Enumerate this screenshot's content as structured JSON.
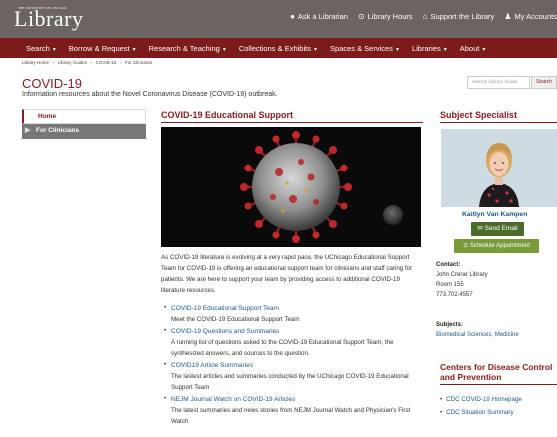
{
  "header": {
    "logo_small": "THE UNIVERSITY OF CHICAGO",
    "logo_big": "Library",
    "links": [
      {
        "icon": "chat-icon",
        "glyph": "💬",
        "label": "Ask a Librarian"
      },
      {
        "icon": "clock-icon",
        "glyph": "⊙",
        "label": "Library Hours"
      },
      {
        "icon": "bank-icon",
        "glyph": "⌂",
        "label": "Support the Library"
      },
      {
        "icon": "user-icon",
        "glyph": "♟",
        "label": "My Accounts"
      }
    ]
  },
  "nav": [
    {
      "label": "Search",
      "caret": "▾"
    },
    {
      "label": "Borrow & Request",
      "caret": "▾"
    },
    {
      "label": "Research & Teaching",
      "caret": "▾"
    },
    {
      "label": "Collections & Exhibits",
      "caret": "▾"
    },
    {
      "label": "Spaces & Services",
      "caret": "▾"
    },
    {
      "label": "Libraries",
      "caret": "▾"
    },
    {
      "label": "About",
      "caret": "▾"
    }
  ],
  "breadcrumb": [
    "Library Home",
    "Library Guides",
    "COVID-19",
    "For Clinicians"
  ],
  "page": {
    "title": "COVID-19",
    "subtitle": "Information resources about the Novel Coronavirus Disease (COVID-19) outbreak."
  },
  "search": {
    "placeholder": "Search Library Guide",
    "button": "Search"
  },
  "sidebar": {
    "items": [
      {
        "label": "Home"
      },
      {
        "label": "For Clinicians"
      }
    ]
  },
  "main": {
    "heading": "COVID-19 Educational Support",
    "paragraph": "As COVID-19 literature is evolving at a very rapid pace, the UChicago Educational Support Team for COVID-19 is offering an educational support team for clinicians and staff caring for patients. We are here to support your team by providing access to additional COVID-19 literature resources.",
    "resources": [
      {
        "link": "COVID-19 Educational Support Team",
        "desc": "Meet the COVID-19 Educational Support Team"
      },
      {
        "link": "COVID-19 Questions and Summaries",
        "desc": "A running list of questions asked to the COVID-19 Educational Support Team, the synthesized answers, and sources to the question."
      },
      {
        "link": "COVID19 Article Summaries",
        "desc": "The lastest articles and summaries conducted by the UChicago COVID-19 Educational Support Team"
      },
      {
        "link": "NEJM Journal Watch on COVID-19 Articles",
        "desc": "The latest summaries and news stories from NEJM Journal Watch and Physician's First Watch"
      }
    ]
  },
  "specialist": {
    "heading": "Subject Specialist",
    "name": "Kaitlyn Van Kampen",
    "email_button": "Send Email",
    "schedule_button": "Schedule Appointment",
    "contact_label": "Contact:",
    "contact_lines": [
      "John Crerar Library",
      "Room 155",
      "773.702.4557"
    ],
    "subjects_label": "Subjects:",
    "subjects": [
      "Biomedical Sciences",
      "Medicine"
    ]
  },
  "cdc": {
    "heading": "Centers for Disease Control and Prevention",
    "links": [
      "CDC COVID-19 Homepage",
      "CDC Situation Summary"
    ]
  },
  "colors": {
    "brand": "#7d1a1a",
    "header_gray": "#6b6461",
    "link": "#1a5a8b",
    "button_green": "#4b6b2a"
  }
}
